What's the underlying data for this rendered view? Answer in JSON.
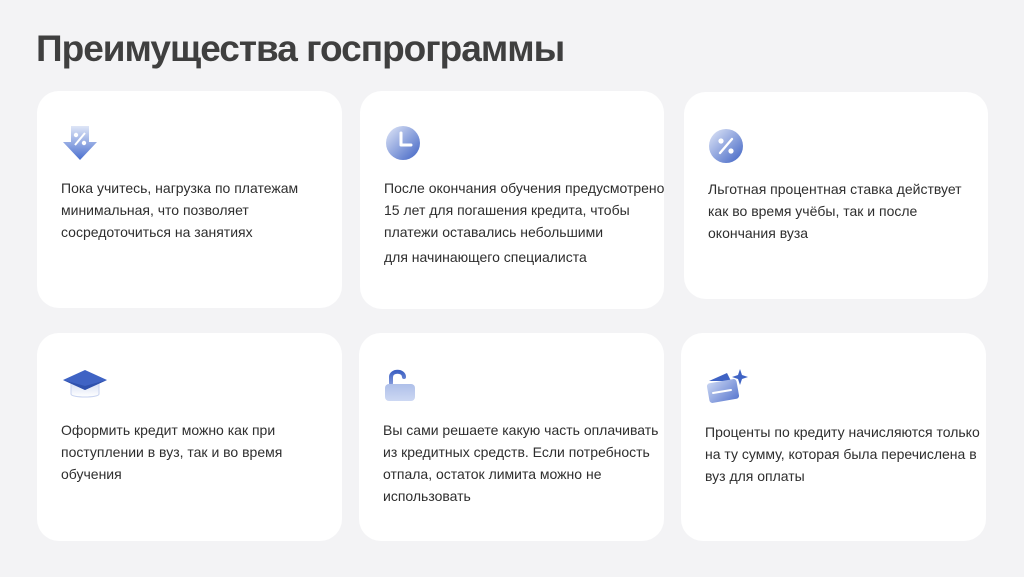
{
  "page": {
    "title": "Преимущества госпрограммы"
  },
  "cards": [
    {
      "icon": "percent-down-arrow-icon",
      "lines": [
        "Пока учитесь, нагрузка по платежам",
        "минимальная, что позволяет",
        "сосредоточиться на занятиях"
      ]
    },
    {
      "icon": "clock-icon",
      "lines": [
        "После окончания обучения предусмотрено",
        "15 лет для погашения кредита, чтобы",
        "платежи оставались небольшими",
        "для начинающего специалиста"
      ]
    },
    {
      "icon": "percent-badge-icon",
      "lines": [
        "Льготная процентная ставка действует",
        "как во время учёбы, так и после",
        "окончания вуза"
      ]
    },
    {
      "icon": "graduation-cap-icon",
      "lines": [
        "Оформить кредит можно как при",
        "поступлении в вуз, так и во время",
        "обучения"
      ]
    },
    {
      "icon": "open-lock-icon",
      "lines": [
        "Вы сами решаете какую часть оплачивать",
        "из кредитных средств. Если потребность",
        "отпала, остаток лимита можно не",
        "использовать"
      ]
    },
    {
      "icon": "wallet-sparkle-icon",
      "lines": [
        "Проценты по кредиту начисляются только",
        "на ту сумму, которая была перечислена в",
        "вуз для оплаты"
      ]
    }
  ],
  "colors": {
    "background": "#f3f3f5",
    "card": "#ffffff",
    "accent_dark": "#3f63c4",
    "accent_light": "#c9d5f2"
  }
}
